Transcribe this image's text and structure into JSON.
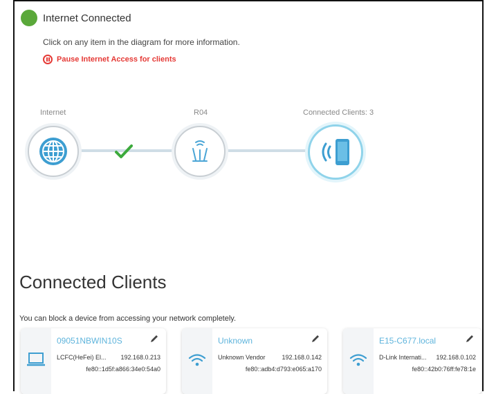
{
  "status": {
    "title": "Internet Connected",
    "color": "#5aa83a"
  },
  "hint": "Click on any item in the diagram for more information.",
  "pause": {
    "label": "Pause Internet Access for clients",
    "color": "#e53935"
  },
  "diagram": {
    "internet_label": "Internet",
    "router_label": "R04",
    "clients_label": "Connected Clients: 3"
  },
  "clients_section": {
    "title": "Connected Clients",
    "subtitle": "You can block a device from accessing your network completely.",
    "clients": [
      {
        "name": "09051NBWIN10S",
        "vendor": "LCFC(HeFei) El...",
        "ipv4": "192.168.0.213",
        "ipv6": "fe80::1d5f:a866:34e0:54a0",
        "icon": "laptop-icon"
      },
      {
        "name": "Unknown",
        "vendor": "Unknown Vendor",
        "ipv4": "192.168.0.142",
        "ipv6": "fe80::adb4:d793:e065:a170",
        "icon": "wifi-icon"
      },
      {
        "name": "E15-C677.local",
        "vendor": "D-Link Internati...",
        "ipv4": "192.168.0.102",
        "ipv6": "fe80::42b0:76ff:fe78:1e",
        "icon": "wifi-icon"
      }
    ]
  },
  "accent_color": "#5eb4dc"
}
